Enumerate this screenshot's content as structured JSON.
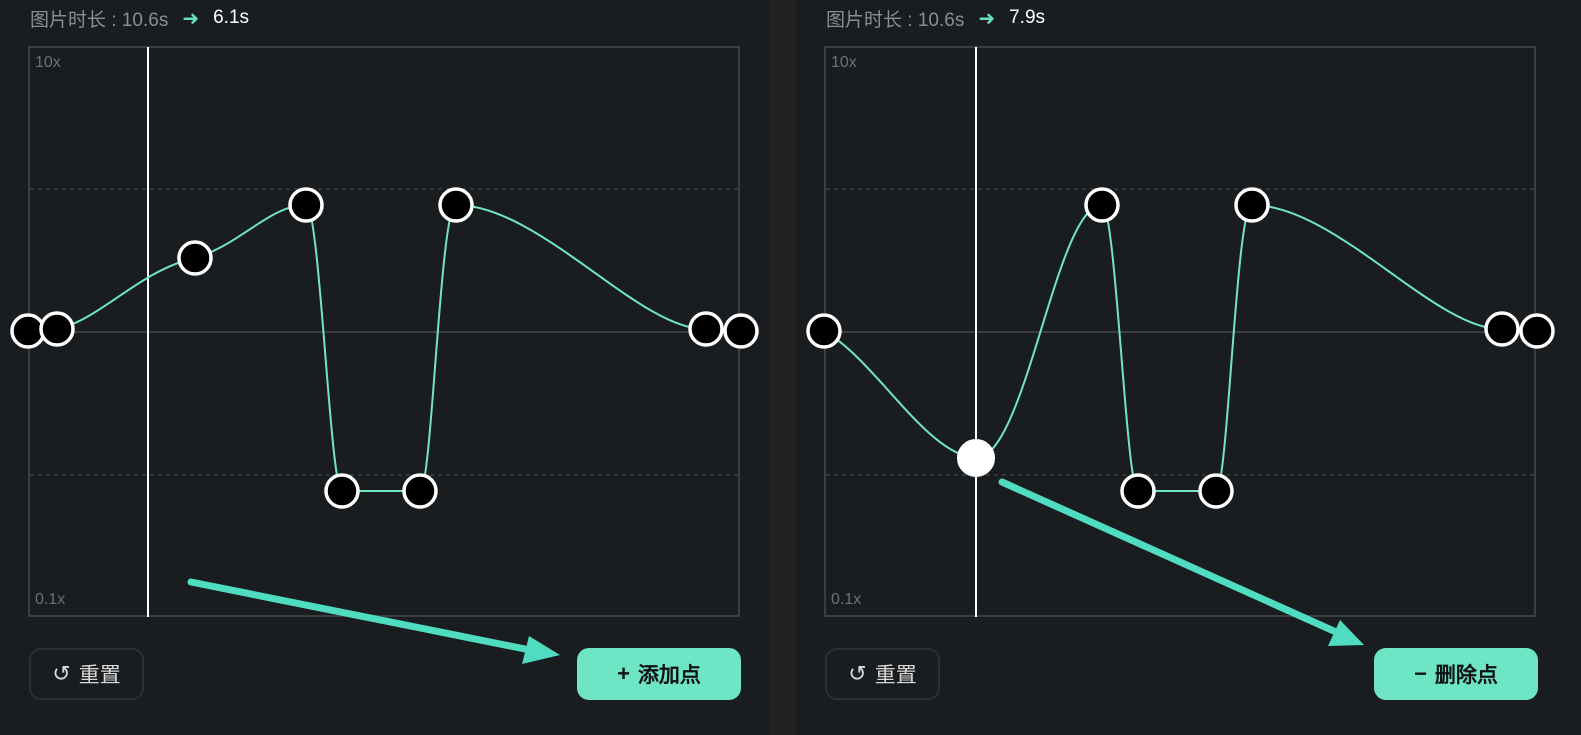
{
  "left_panel": {
    "duration_label": "图片时长 : 10.6s",
    "duration_new": "6.1s",
    "axis_max": "10x",
    "axis_min": "0.1x",
    "reset_label": "重置",
    "action_label": "添加点"
  },
  "right_panel": {
    "duration_label": "图片时长 : 10.6s",
    "duration_new": "7.9s",
    "axis_max": "10x",
    "axis_min": "0.1x",
    "reset_label": "重置",
    "action_label": "删除点"
  },
  "colors": {
    "background": "#1a1d20",
    "accent": "#6ee6c6",
    "curve": "#6ee6c6",
    "point_fill": "#000000",
    "point_stroke": "#ffffff",
    "selected_point_fill": "#ffffff"
  },
  "icons": {
    "duration_arrow": "arrow-right-icon",
    "reset": "rotate-ccw-icon",
    "add": "plus-icon",
    "delete": "minus-icon",
    "annotation": "teal-arrow-pointer"
  }
}
